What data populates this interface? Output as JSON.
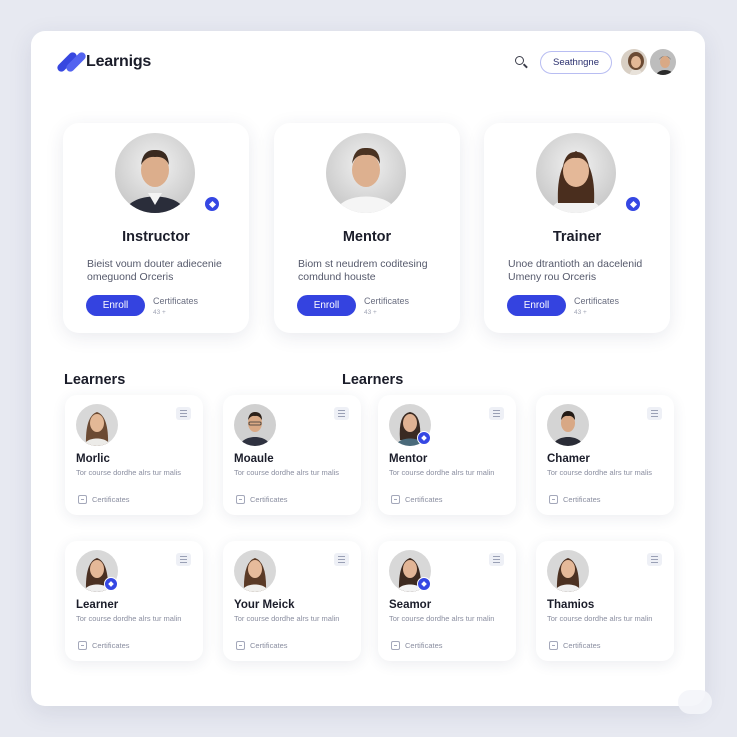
{
  "header": {
    "logo_text": "Learnigs",
    "search_chip": "Seathngne",
    "avatars": [
      "user-avatar-1",
      "user-avatar-2"
    ]
  },
  "featured": [
    {
      "title": "Instructor",
      "desc_line1": "Bieist voum douter adiecenie",
      "desc_line2": "omeguond Orceris",
      "enroll": "Enroll",
      "cert_label": "Certificates",
      "cert_count": "43 +"
    },
    {
      "title": "Mentor",
      "desc_line1": "Biom st neudrem coditesing",
      "desc_line2": "comdund houste",
      "enroll": "Enroll",
      "cert_label": "Certificates",
      "cert_count": "43 +"
    },
    {
      "title": "Trainer",
      "desc_line1": "Unoe dtrantioth an dacelenid",
      "desc_line2": "Umeny rou Orceris",
      "enroll": "Enroll",
      "cert_label": "Certificates",
      "cert_count": "43 +"
    }
  ],
  "sections": {
    "left": "Learners",
    "right": "Learners"
  },
  "learners_row1": [
    {
      "name": "Morlic",
      "meta": "Tor course dordhe alrs tur malis",
      "cert": "Certificates"
    },
    {
      "name": "Moaule",
      "meta": "Tor course dordhe alrs tur malis",
      "cert": "Certificates"
    },
    {
      "name": "Mentor",
      "meta": "Tor course dordhe alrs tur malin",
      "cert": "Certificates"
    },
    {
      "name": "Chamer",
      "meta": "Tor course dordhe alrs tur malis",
      "cert": "Certificates"
    }
  ],
  "learners_row2": [
    {
      "name": "Learner",
      "meta": "Tor course dordhe alrs tur malin",
      "cert": "Certificates"
    },
    {
      "name": "Your Meick",
      "meta": "Tor course dordhe alrs tur malin",
      "cert": "Certificates"
    },
    {
      "name": "Seamor",
      "meta": "Tor course dordhe alrs tur malin",
      "cert": "Certificates"
    },
    {
      "name": "Thamios",
      "meta": "Tor course dordhe alrs tur malin",
      "cert": "Certificates"
    }
  ],
  "colors": {
    "accent": "#3443e0",
    "background": "#e7e9f1",
    "card": "#ffffff"
  }
}
